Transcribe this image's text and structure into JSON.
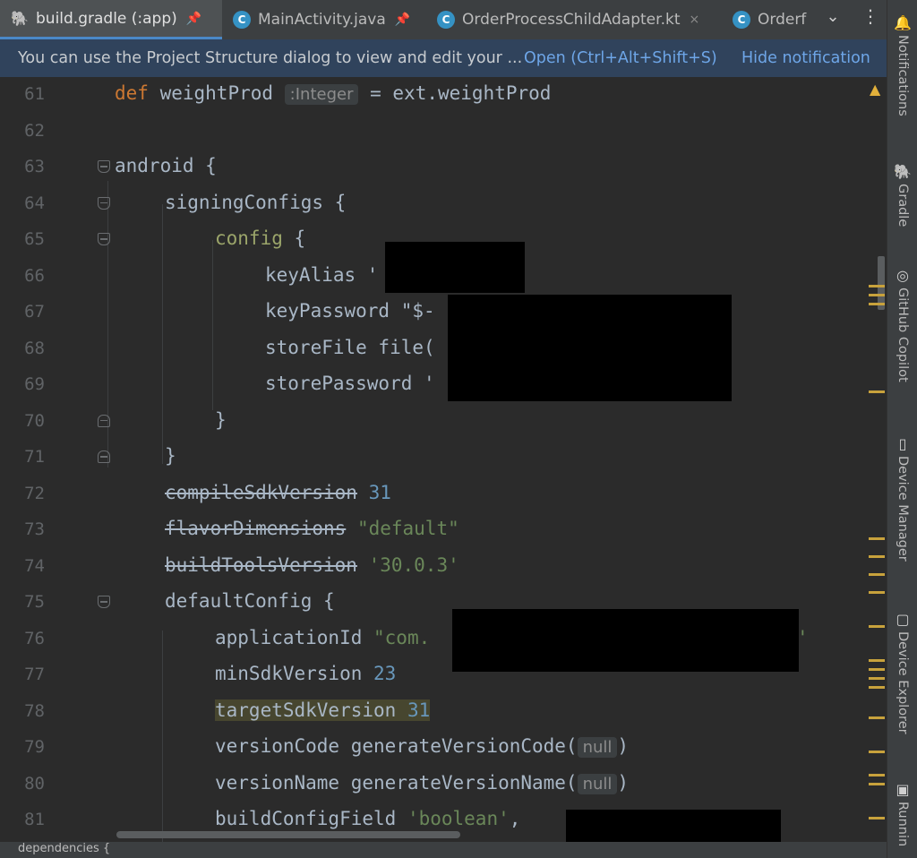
{
  "tabs": [
    {
      "label": "build.gradle (:app)",
      "active": true,
      "icon": "gradle-icon",
      "pin": "pin-icon"
    },
    {
      "label": "MainActivity.java",
      "active": false,
      "icon": "java-class-icon",
      "pin": "pin-icon"
    },
    {
      "label": "OrderProcessChildAdapter.kt",
      "active": false,
      "icon": "kotlin-class-icon",
      "close": "×"
    },
    {
      "label": "Orderf",
      "active": false,
      "icon": "kotlin-class-icon"
    }
  ],
  "tab_more": "⌄",
  "tab_menu": "⋮",
  "banner": {
    "message": "You can use the Project Structure dialog to view and edit your ...",
    "open": "Open (Ctrl+Alt+Shift+S)",
    "hide": "Hide notification"
  },
  "code": {
    "l61": {
      "num": "61",
      "a": "def",
      "b": " weightProd ",
      "hint": ":Integer",
      "c": " = ext.weightProd"
    },
    "l62": {
      "num": "62"
    },
    "l63": {
      "num": "63",
      "text": "android {"
    },
    "l64": {
      "num": "64",
      "text": "signingConfigs {"
    },
    "l65": {
      "num": "65",
      "a": "config",
      "b": " {"
    },
    "l66": {
      "num": "66",
      "text": "keyAlias '"
    },
    "l67": {
      "num": "67",
      "text": "keyPassword \"$-"
    },
    "l68": {
      "num": "68",
      "text": "storeFile file("
    },
    "l69": {
      "num": "69",
      "text": "storePassword '"
    },
    "l70": {
      "num": "70",
      "text": "}"
    },
    "l71": {
      "num": "71",
      "text": "}"
    },
    "l72": {
      "num": "72",
      "a": "compileSdkVersion",
      "b": " ",
      "c": "31"
    },
    "l73": {
      "num": "73",
      "a": "flavorDimensions",
      "b": " ",
      "c": "\"default\""
    },
    "l74": {
      "num": "74",
      "a": "buildToolsVersion",
      "b": " ",
      "c": "'30.0.3'"
    },
    "l75": {
      "num": "75",
      "text": "defaultConfig {"
    },
    "l76": {
      "num": "76",
      "a": "applicationId ",
      "b": "\"com.",
      "c": "'"
    },
    "l77": {
      "num": "77",
      "a": "minSdkVersion ",
      "b": "23"
    },
    "l78": {
      "num": "78",
      "a": "targetSdkVersion ",
      "b": "31"
    },
    "l79": {
      "num": "79",
      "a": "versionCode generateVersionCode(",
      "hint": "null",
      "b": ")"
    },
    "l80": {
      "num": "80",
      "a": "versionName generateVersionName(",
      "hint": "null",
      "b": ")"
    },
    "l81": {
      "num": "81",
      "a": "buildConfigField ",
      "b": "'boolean'",
      "c": ","
    }
  },
  "tools": [
    {
      "label": "Notifications",
      "icon": "bell-icon"
    },
    {
      "label": "Gradle",
      "icon": "gradle-icon"
    },
    {
      "label": "GitHub Copilot",
      "icon": "copilot-icon"
    },
    {
      "label": "Device Manager",
      "icon": "device-manager-icon"
    },
    {
      "label": "Device Explorer",
      "icon": "device-explorer-icon"
    },
    {
      "label": "Runnin",
      "icon": "running-devices-icon"
    }
  ],
  "warning_icon": "warning-icon",
  "bottom_text": "dependencies {",
  "colors": {
    "accent": "#4a88c7",
    "keyword": "#cc7832",
    "string": "#6a8759",
    "number": "#6897bb",
    "banner": "#30435c"
  }
}
